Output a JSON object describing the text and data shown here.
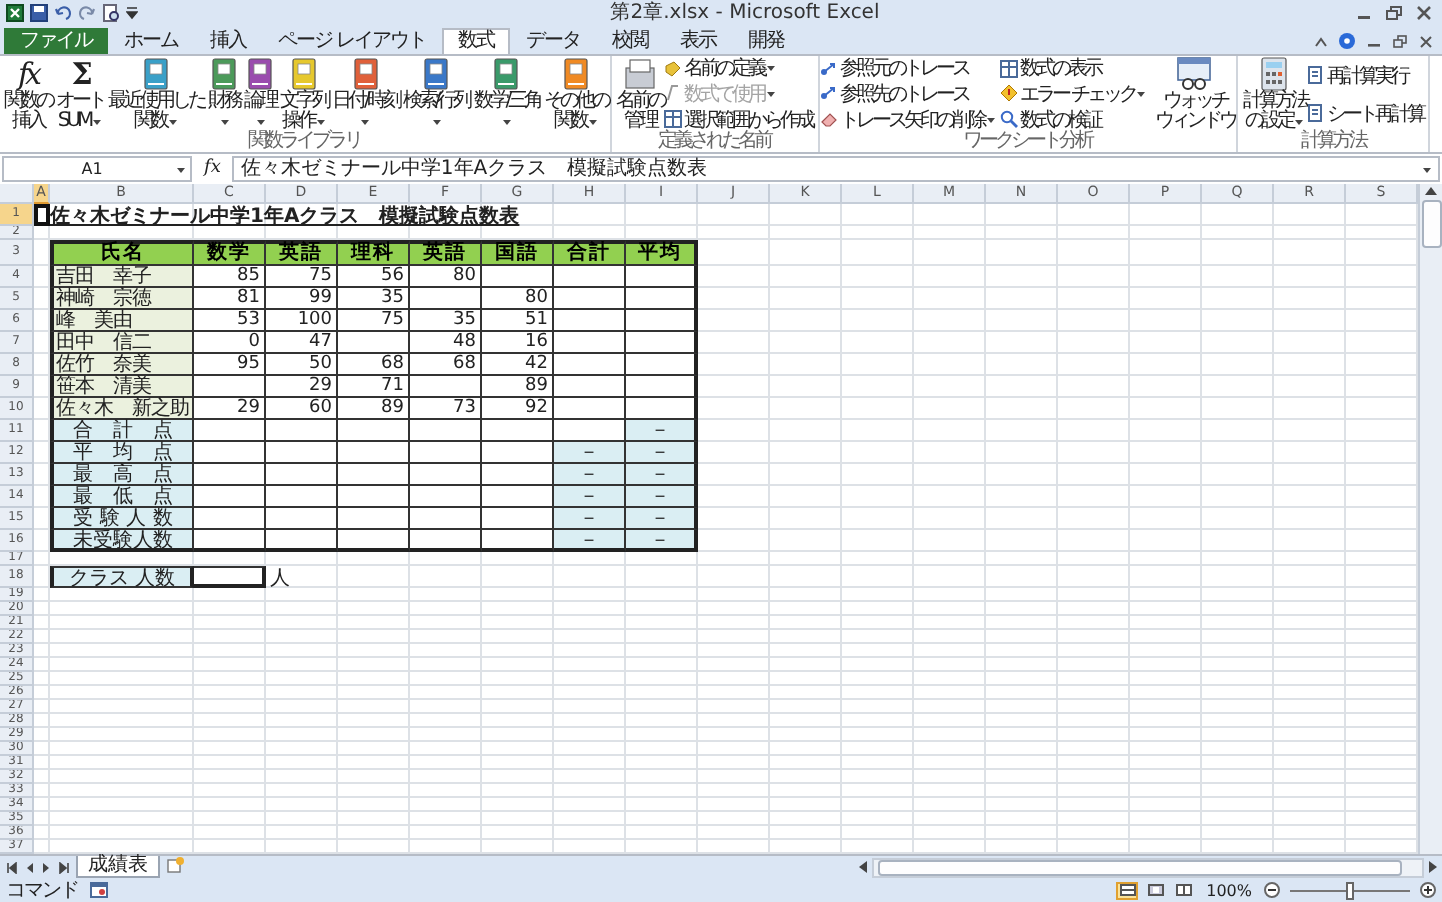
{
  "window": {
    "title": "第2章.xlsx - Microsoft Excel"
  },
  "tabs": [
    {
      "label": "ファイル",
      "kind": "file",
      "selected": false
    },
    {
      "label": "ホーム",
      "kind": "tab",
      "selected": false
    },
    {
      "label": "挿入",
      "kind": "tab",
      "selected": false
    },
    {
      "label": "ページ レイアウト",
      "kind": "tab",
      "selected": false
    },
    {
      "label": "数式",
      "kind": "tab",
      "selected": true
    },
    {
      "label": "データ",
      "kind": "tab",
      "selected": false
    },
    {
      "label": "校閲",
      "kind": "tab",
      "selected": false
    },
    {
      "label": "表示",
      "kind": "tab",
      "selected": false
    },
    {
      "label": "開発",
      "kind": "tab",
      "selected": false
    }
  ],
  "ribbon": [
    {
      "label": "関数ライブラリ",
      "items": [
        {
          "kind": "large",
          "glyph": "fx",
          "lines": [
            "関数の",
            "挿入"
          ],
          "menu": false
        },
        {
          "kind": "large",
          "glyph": "Σ",
          "lines": [
            "オート",
            "SUM"
          ],
          "menu": true
        },
        {
          "kind": "large",
          "lines": [
            "最近使用した",
            "関数"
          ],
          "menu": true
        },
        {
          "kind": "large",
          "lines": [
            "財務"
          ],
          "menu": true
        },
        {
          "kind": "large",
          "lines": [
            "論理"
          ],
          "menu": true
        },
        {
          "kind": "large",
          "lines": [
            "文字列",
            "操作"
          ],
          "menu": true
        },
        {
          "kind": "large",
          "lines": [
            "日付/時刻"
          ],
          "menu": true
        },
        {
          "kind": "large",
          "lines": [
            "検索/行列"
          ],
          "menu": true
        },
        {
          "kind": "large",
          "lines": [
            "数学/三角"
          ],
          "menu": true
        },
        {
          "kind": "large",
          "lines": [
            "その他の",
            "関数"
          ],
          "menu": true
        }
      ]
    },
    {
      "label": "定義された名前",
      "items": [
        {
          "kind": "large",
          "lines": [
            "名前の",
            "管理"
          ],
          "menu": false
        },
        {
          "kind": "small",
          "label": "名前の定義",
          "menu": true,
          "disabled": false
        },
        {
          "kind": "small",
          "label": "数式で使用",
          "menu": true,
          "disabled": true
        },
        {
          "kind": "small",
          "label": "選択範囲から作成",
          "menu": false,
          "disabled": false
        }
      ]
    },
    {
      "label": "ワークシート分析",
      "items": [
        {
          "kind": "small",
          "label": "参照元のトレース",
          "menu": false,
          "disabled": false
        },
        {
          "kind": "small",
          "label": "参照先のトレース",
          "menu": false,
          "disabled": false
        },
        {
          "kind": "small",
          "label": "トレース矢印の削除",
          "menu": true,
          "disabled": false
        },
        {
          "kind": "small",
          "label": "数式の表示",
          "menu": false,
          "disabled": false
        },
        {
          "kind": "small",
          "label": "エラー チェック",
          "menu": true,
          "disabled": false
        },
        {
          "kind": "small",
          "label": "数式の検証",
          "menu": false,
          "disabled": false
        },
        {
          "kind": "large",
          "lines": [
            "ウォッチ",
            "ウィンドウ"
          ],
          "menu": false
        }
      ]
    },
    {
      "label": "計算方法",
      "items": [
        {
          "kind": "large",
          "lines": [
            "計算方法",
            "の設定"
          ],
          "menu": true
        },
        {
          "kind": "small",
          "label": "再計算実行",
          "menu": false,
          "disabled": false
        },
        {
          "kind": "small",
          "label": "シート再計算",
          "menu": false,
          "disabled": false
        }
      ]
    }
  ],
  "formula_bar": {
    "name_box": "A1",
    "fx": "fx",
    "formula": "佐々木ゼミナール中学1年Aクラス　模擬試験点数表"
  },
  "columns": [
    {
      "label": "A",
      "selected": true
    },
    {
      "label": "B",
      "selected": false
    },
    {
      "label": "C",
      "selected": false
    },
    {
      "label": "D",
      "selected": false
    },
    {
      "label": "E",
      "selected": false
    },
    {
      "label": "F",
      "selected": false
    },
    {
      "label": "G",
      "selected": false
    },
    {
      "label": "H",
      "selected": false
    },
    {
      "label": "I",
      "selected": false
    },
    {
      "label": "J",
      "selected": false
    },
    {
      "label": "K",
      "selected": false
    },
    {
      "label": "L",
      "selected": false
    },
    {
      "label": "M",
      "selected": false
    },
    {
      "label": "N",
      "selected": false
    },
    {
      "label": "O",
      "selected": false
    },
    {
      "label": "P",
      "selected": false
    },
    {
      "label": "Q",
      "selected": false
    },
    {
      "label": "R",
      "selected": false
    },
    {
      "label": "S",
      "selected": false
    }
  ],
  "rows": [
    {
      "label": "1",
      "selected": true
    },
    {
      "label": "2",
      "selected": false
    },
    {
      "label": "3",
      "selected": false
    },
    {
      "label": "4",
      "selected": false
    },
    {
      "label": "5",
      "selected": false
    },
    {
      "label": "6",
      "selected": false
    },
    {
      "label": "7",
      "selected": false
    },
    {
      "label": "8",
      "selected": false
    },
    {
      "label": "9",
      "selected": false
    },
    {
      "label": "10",
      "selected": false
    },
    {
      "label": "11",
      "selected": false
    },
    {
      "label": "12",
      "selected": false
    },
    {
      "label": "13",
      "selected": false
    },
    {
      "label": "14",
      "selected": false
    },
    {
      "label": "15",
      "selected": false
    },
    {
      "label": "16",
      "selected": false
    },
    {
      "label": "17",
      "selected": false
    },
    {
      "label": "18",
      "selected": false
    },
    {
      "label": "19",
      "selected": false
    },
    {
      "label": "20",
      "selected": false
    },
    {
      "label": "21",
      "selected": false
    },
    {
      "label": "22",
      "selected": false
    },
    {
      "label": "23",
      "selected": false
    },
    {
      "label": "24",
      "selected": false
    },
    {
      "label": "25",
      "selected": false
    },
    {
      "label": "26",
      "selected": false
    },
    {
      "label": "27",
      "selected": false
    },
    {
      "label": "28",
      "selected": false
    },
    {
      "label": "29",
      "selected": false
    },
    {
      "label": "30",
      "selected": false
    },
    {
      "label": "31",
      "selected": false
    },
    {
      "label": "32",
      "selected": false
    },
    {
      "label": "33",
      "selected": false
    },
    {
      "label": "34",
      "selected": false
    },
    {
      "label": "35",
      "selected": false
    },
    {
      "label": "36",
      "selected": false
    },
    {
      "label": "37",
      "selected": false
    }
  ],
  "sheet": {
    "title": "佐々木ゼミナール中学1年Aクラス　模擬試験点数表",
    "headers": [
      "氏名",
      "数学",
      "英語",
      "理科",
      "英語",
      "国語",
      "合計",
      "平均"
    ],
    "students": [
      {
        "name": "吉田　幸子",
        "scores": {
          "C": "85",
          "D": "75",
          "E": "56",
          "F": "80"
        }
      },
      {
        "name": "神崎　宗徳",
        "scores": {
          "C": "81",
          "D": "99",
          "E": "35",
          "G": "80"
        }
      },
      {
        "name": "峰　美由",
        "scores": {
          "C": "53",
          "D": "100",
          "E": "75",
          "F": "35",
          "G": "51"
        }
      },
      {
        "name": "田中　信二",
        "scores": {
          "C": "0",
          "D": "47",
          "F": "48",
          "G": "16"
        }
      },
      {
        "name": "佐竹　奈美",
        "scores": {
          "C": "95",
          "D": "50",
          "E": "68",
          "F": "68",
          "G": "42"
        }
      },
      {
        "name": "笹本　清美",
        "scores": {
          "D": "29",
          "E": "71",
          "G": "89"
        }
      },
      {
        "name": "佐々木　新之助",
        "scores": {
          "C": "29",
          "D": "60",
          "E": "89",
          "F": "73",
          "G": "92"
        }
      }
    ],
    "summary": [
      {
        "label": "合　計　点",
        "total": {
          "shaded": false
        },
        "average": {
          "text": "－",
          "shaded": true
        }
      },
      {
        "label": "平　均　点",
        "total": {
          "text": "－",
          "shaded": true
        },
        "average": {
          "text": "－",
          "shaded": true
        }
      },
      {
        "label": "最　高　点",
        "total": {
          "text": "－",
          "shaded": true
        },
        "average": {
          "text": "－",
          "shaded": true
        }
      },
      {
        "label": "最　低　点",
        "total": {
          "text": "－",
          "shaded": true
        },
        "average": {
          "text": "－",
          "shaded": true
        }
      },
      {
        "label": "受 験 人 数",
        "total": {
          "text": "－",
          "shaded": true
        },
        "average": {
          "text": "－",
          "shaded": true
        }
      },
      {
        "label": "未受験人数",
        "total": {
          "text": "－",
          "shaded": true
        },
        "average": {
          "text": "－",
          "shaded": true
        }
      }
    ],
    "class_count": {
      "label": "クラス 人数",
      "unit": "人"
    }
  },
  "sheet_tabs": [
    {
      "label": "成績表",
      "selected": true
    }
  ],
  "status_bar": {
    "mode": "コマンド",
    "views": [
      {
        "selected": true
      },
      {
        "selected": false
      },
      {
        "selected": false
      }
    ],
    "zoom": "100%",
    "zoom_slider": {
      "level": 0.5
    }
  }
}
